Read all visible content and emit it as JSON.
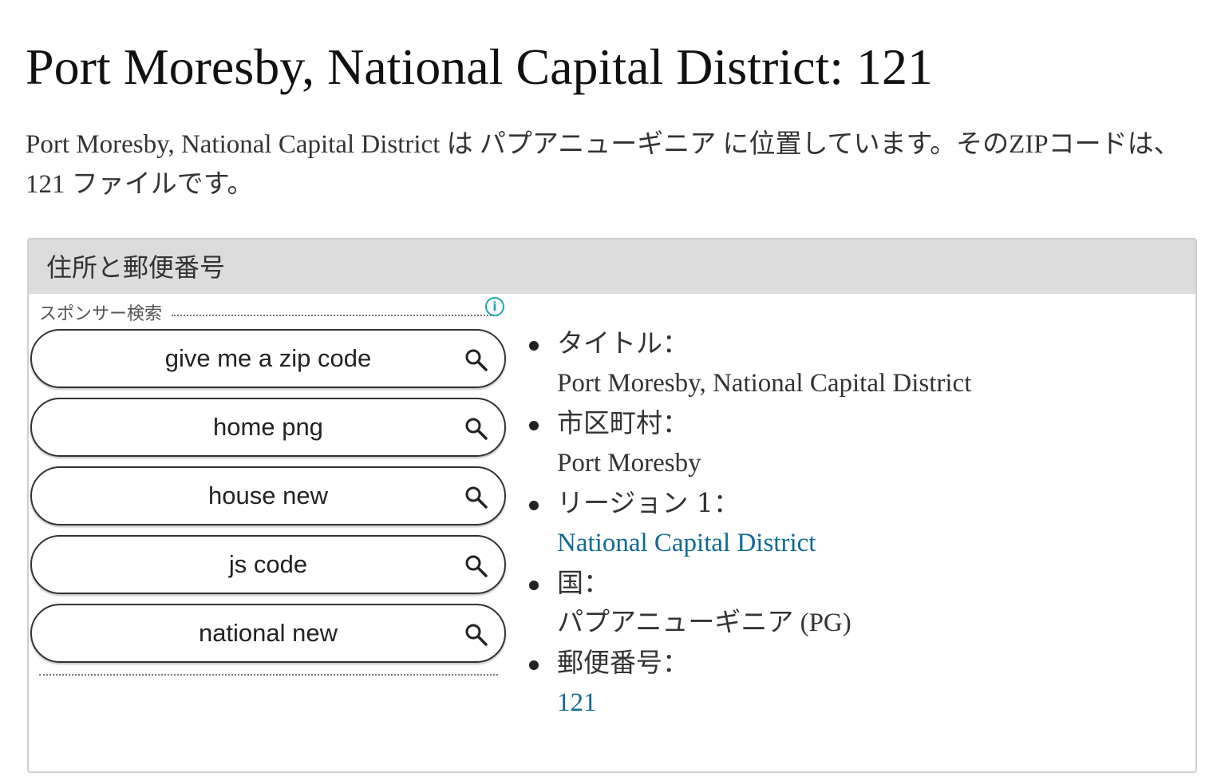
{
  "page": {
    "title": "Port Moresby, National Capital District: 121",
    "intro": "Port Moresby, National Capital District は パプアニューギニア に位置しています。そのZIPコードは、 121 ファイルです。"
  },
  "panel": {
    "header": "住所と郵便番号",
    "sponsor": {
      "label": "スポンサー検索",
      "info_icon": "info-icon",
      "searches": [
        "give me a zip code",
        "home png",
        "house new",
        "js code",
        "national new"
      ],
      "search_icon": "search-icon"
    },
    "details": [
      {
        "label": "タイトル：",
        "value": "Port Moresby, National Capital District"
      },
      {
        "label": "市区町村：",
        "value": "Port Moresby"
      },
      {
        "label": "リージョン 1：",
        "value": "National Capital District"
      },
      {
        "label": "国：",
        "value": "パプアニューギニア (PG)"
      },
      {
        "label": "郵便番号：",
        "value": "121"
      }
    ]
  },
  "colors": {
    "link": "#0f6a95",
    "info_icon": "#1aa6b7",
    "header_bg": "#dcdcdc"
  }
}
